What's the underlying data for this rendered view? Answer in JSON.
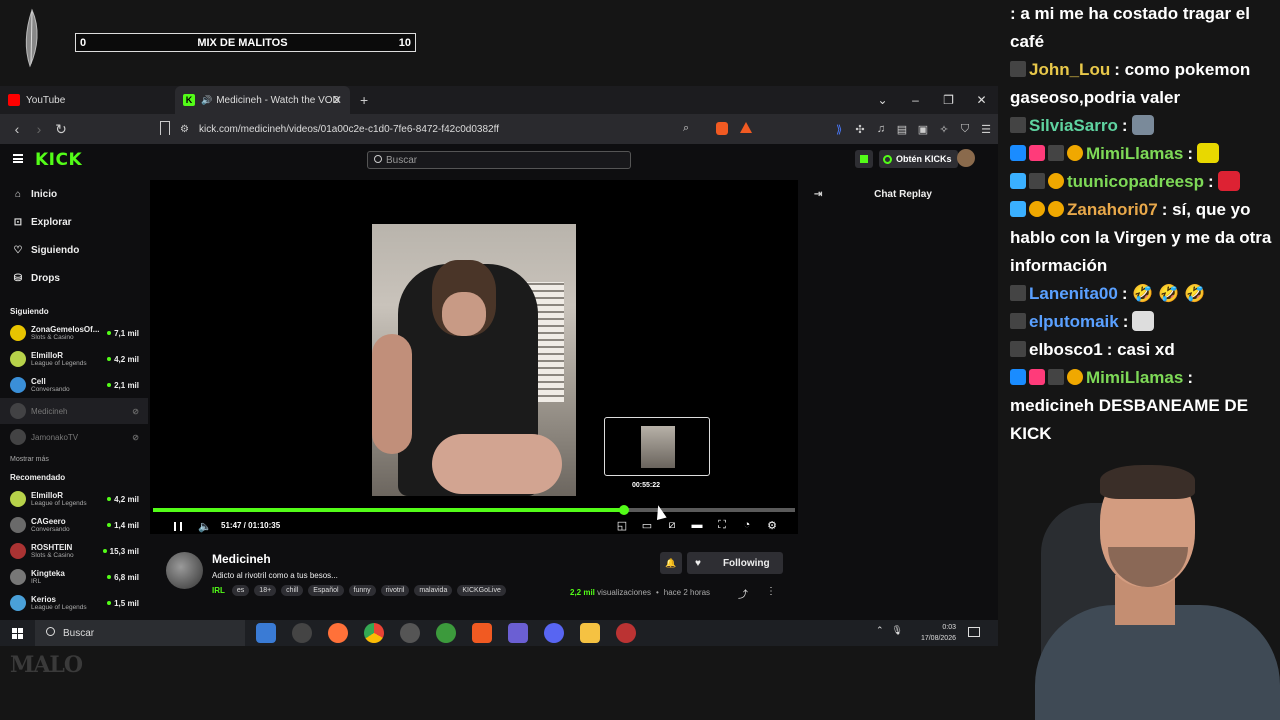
{
  "overlay": {
    "mix_bar": {
      "left": "0",
      "title": "MIX DE MALITOS",
      "right": "10"
    },
    "bottom_logo": "MALO"
  },
  "browser": {
    "tabs": [
      {
        "label": "YouTube",
        "active": false
      },
      {
        "label": "Medicineh - Watch the VOD",
        "active": true
      }
    ],
    "new_tab": "+",
    "window_controls": [
      "⌄",
      "–",
      "❐",
      "✕"
    ],
    "url": "kick.com/medicineh/videos/01a00c2e-c1d0-7fe6-8472-f42c0d0382ff"
  },
  "kick": {
    "logo": "KICK",
    "search_placeholder": "Buscar",
    "kicks_button": "Obtén KICKs",
    "nav": [
      {
        "icon": "home-icon",
        "glyph": "⌂",
        "label": "Inicio"
      },
      {
        "icon": "compass-icon",
        "glyph": "⊡",
        "label": "Explorar"
      },
      {
        "icon": "heart-icon",
        "glyph": "♡",
        "label": "Siguiendo"
      },
      {
        "icon": "drops-icon",
        "glyph": "⛁",
        "label": "Drops"
      }
    ],
    "following_heading": "Siguiendo",
    "following": [
      {
        "name": "ZonaGemelosOf...",
        "category": "Slots & Casino",
        "viewers": "7,1 mil",
        "color": "#e8c400",
        "live": true
      },
      {
        "name": "ElmilloR",
        "category": "League of Legends",
        "viewers": "4,2 mil",
        "color": "#b7d24a",
        "live": true
      },
      {
        "name": "Cell",
        "category": "Conversando",
        "viewers": "2,1 mil",
        "color": "#3a8fd8",
        "live": true
      },
      {
        "name": "Medicineh",
        "category": "",
        "viewers": "",
        "color": "#666",
        "live": false
      },
      {
        "name": "JamonakoTV",
        "category": "",
        "viewers": "",
        "color": "#777",
        "live": false
      }
    ],
    "show_more": "Mostrar más",
    "recommended_heading": "Recomendado",
    "recommended": [
      {
        "name": "ElmilloR",
        "category": "League of Legends",
        "viewers": "4,2 mil",
        "color": "#b7d24a"
      },
      {
        "name": "CAGeero",
        "category": "Conversando",
        "viewers": "1,4 mil",
        "color": "#6a6a6a"
      },
      {
        "name": "ROSHTEIN",
        "category": "Slots & Casino",
        "viewers": "15,3 mil",
        "color": "#a33"
      },
      {
        "name": "Kingteka",
        "category": "IRL",
        "viewers": "6,8 mil",
        "color": "#777"
      },
      {
        "name": "Kerios",
        "category": "League of Legends",
        "viewers": "1,5 mil",
        "color": "#4aa0d8"
      }
    ],
    "player": {
      "current_time": "51:47",
      "duration": "01:10:35",
      "time_display": "51:47 / 01:10:35",
      "progress_fraction": 0.733,
      "preview_time": "00:55:22"
    },
    "chat_replay_title": "Chat Replay",
    "streamer": {
      "name": "Medicineh",
      "title": "Adicto al rivotril como a tus besos...",
      "category": "IRL",
      "tags": [
        "es",
        "18+",
        "chill",
        "Español",
        "funny",
        "rivotril",
        "malavida",
        "KICKGoLive"
      ],
      "follow_label": "Following",
      "views": "2,2 mil",
      "views_label": "visualizaciones",
      "separator": "•",
      "ago": "hace 2 horas"
    }
  },
  "taskbar": {
    "search_placeholder": "Buscar",
    "time": "0:03",
    "date": "17/08/2026"
  },
  "chat_overlay": {
    "messages": [
      {
        "user": "",
        "user_color": "#fff",
        "text": ": a mi me ha costado tragar el café",
        "badges": []
      },
      {
        "user": "John_Lou",
        "user_color": "#e8c84a",
        "text": ": como pokemon gaseoso,podria valer",
        "badges": [
          "b-dark"
        ]
      },
      {
        "user": "SilviaSarro",
        "user_color": "#5fd3a0",
        "text": ":",
        "badges": [
          "b-dark"
        ],
        "emote": "#7a8a9a"
      },
      {
        "user": "MimiLlamas",
        "user_color": "#7ed957",
        "text": ":",
        "badges": [
          "b-blue",
          "b-pink",
          "b-dark",
          "b-gold"
        ],
        "emote": "#e8d800"
      },
      {
        "user": "tuunicopadreesp",
        "user_color": "#7ed957",
        "text": ":",
        "badges": [
          "b-cube",
          "b-dark",
          "b-gold"
        ],
        "emote": "#d23"
      },
      {
        "user": "Zanahori07",
        "user_color": "#e8a84a",
        "text": ": sí, que yo hablo con la Virgen y me da otra información",
        "badges": [
          "b-cube",
          "b-gold",
          "b-gold"
        ]
      },
      {
        "user": "Lanenita00",
        "user_color": "#5aa0ff",
        "text": ": 🤣 🤣 🤣",
        "badges": [
          "b-dark"
        ]
      },
      {
        "user": "elputomaik",
        "user_color": "#5aa0ff",
        "text": ":",
        "badges": [
          "b-dark"
        ],
        "emote": "#ddd"
      },
      {
        "user": "elbosco1",
        "user_color": "#fff",
        "text": ": casi xd",
        "badges": [
          "b-dark"
        ]
      },
      {
        "user": "MimiLlamas",
        "user_color": "#7ed957",
        "text": ": medicineh DESBANEAME DE KICK",
        "badges": [
          "b-blue",
          "b-pink",
          "b-dark",
          "b-gold"
        ]
      }
    ]
  }
}
